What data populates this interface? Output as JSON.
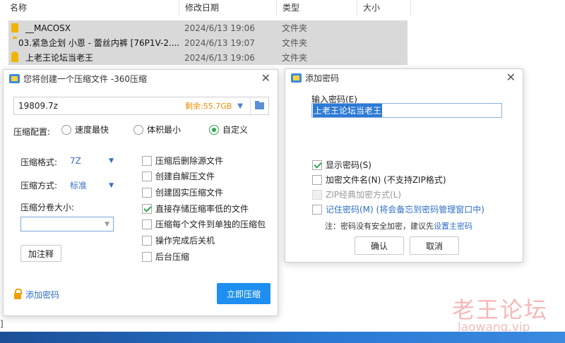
{
  "explorer": {
    "columns": [
      "名称",
      "修改日期",
      "类型",
      "大小"
    ],
    "rows": [
      {
        "name": "__MACOSX",
        "date": "2024/6/13 19:06",
        "type": "文件夹"
      },
      {
        "name": "03.紧急企划 小恩 - 蕾丝内裤 [76P1V-2....",
        "date": "2024/6/13 19:07",
        "type": "文件夹"
      },
      {
        "name": "上老王论坛当老王",
        "date": "2024/6/13 19:06",
        "type": "文件夹"
      }
    ]
  },
  "compress_dialog": {
    "title": "您将创建一个压缩文件 -360压缩",
    "file_name": "19809.7z",
    "remaining_space": "剩余:55.7GB",
    "config_label": "压缩配置:",
    "modes": [
      {
        "label": "速度最快",
        "selected": false
      },
      {
        "label": "体积最小",
        "selected": false
      },
      {
        "label": "自定义",
        "selected": true
      }
    ],
    "format_label": "压缩格式:",
    "format_value": "7Z",
    "method_label": "压缩方式:",
    "method_value": "标准",
    "split_label": "压缩分卷大小:",
    "split_value": "",
    "comment_button": "加注释",
    "options": [
      {
        "label": "压缩后删除源文件",
        "checked": false
      },
      {
        "label": "创建自解压文件",
        "checked": false
      },
      {
        "label": "创建固实压缩文件",
        "checked": false
      },
      {
        "label": "直接存储压缩率低的文件",
        "checked": true
      },
      {
        "label": "压缩每个文件到单独的压缩包",
        "checked": false
      },
      {
        "label": "操作完成后关机",
        "checked": false
      },
      {
        "label": "后台压缩",
        "checked": false
      }
    ],
    "add_password_link": "添加密码",
    "compress_now_button": "立即压缩"
  },
  "password_dialog": {
    "title": "添加密码",
    "input_label": "输入密码(E)",
    "password_value": "上老王论坛当老王",
    "options": [
      {
        "label": "显示密码(S)",
        "checked": true,
        "disabled": false,
        "link": false
      },
      {
        "label": "加密文件名(N) (不支持ZIP格式)",
        "checked": false,
        "disabled": false,
        "link": false
      },
      {
        "label": "ZIP经典加密方式(L)",
        "checked": false,
        "disabled": true,
        "link": false
      },
      {
        "label": "记住密码(M) (将会备忘到密码管理窗口中)",
        "checked": false,
        "disabled": false,
        "link": true
      }
    ],
    "note_prefix": "注：密码没有安全加密，建议先",
    "note_link": "设置主密码",
    "ok_button": "确认",
    "cancel_button": "取消"
  },
  "watermark": {
    "text_cn": "老王论坛",
    "text_en": "laowang.vip"
  },
  "colors": {
    "accent_blue": "#1e8ff0",
    "check_green": "#2aa94c",
    "remaining_orange": "#f08c00",
    "link_blue": "#2f6fc9"
  }
}
